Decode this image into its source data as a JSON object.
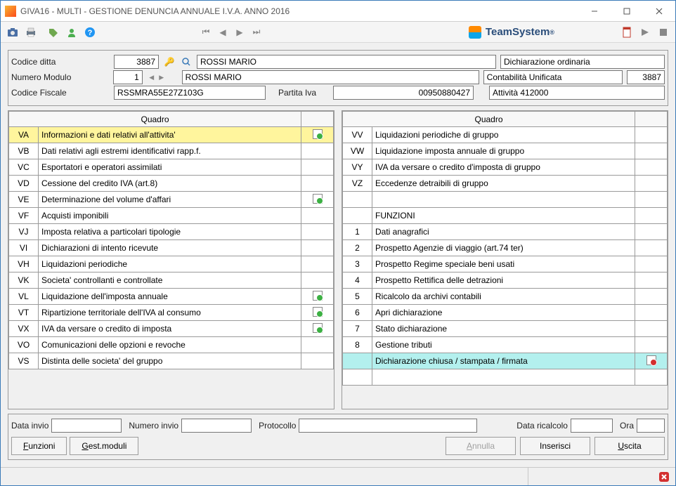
{
  "window": {
    "title": "GIVA16  - MULTI -  GESTIONE DENUNCIA ANNUALE I.V.A. ANNO 2016"
  },
  "brand": "TeamSystem",
  "header": {
    "codice_ditta_lbl": "Codice ditta",
    "codice_ditta": "3887",
    "nome1": "ROSSI MARIO",
    "dichiarazione": "Dichiarazione ordinaria",
    "numero_modulo_lbl": "Numero Modulo",
    "numero_modulo": "1",
    "nome2": "ROSSI MARIO",
    "contab_lbl": "Contabilità Unificata",
    "contab_val": "3887",
    "codice_fiscale_lbl": "Codice Fiscale",
    "codice_fiscale": "RSSMRA55E27Z103G",
    "partita_iva_lbl": "Partita Iva",
    "partita_iva": "00950880427",
    "attivita": "Attività 412000"
  },
  "table_header": "Quadro",
  "left_rows": [
    {
      "code": "VA",
      "desc": "Informazioni e dati relativi all'attivita'",
      "flag": true,
      "selected": true
    },
    {
      "code": "VB",
      "desc": "Dati relativi agli estremi identificativi rapp.f."
    },
    {
      "code": "VC",
      "desc": "Esportatori e operatori assimilati"
    },
    {
      "code": "VD",
      "desc": "Cessione del credito IVA (art.8)"
    },
    {
      "code": "VE",
      "desc": "Determinazione del volume d'affari",
      "flag": true
    },
    {
      "code": "VF",
      "desc": "Acquisti imponibili"
    },
    {
      "code": "VJ",
      "desc": "Imposta relativa a particolari tipologie"
    },
    {
      "code": "VI",
      "desc": "Dichiarazioni di intento ricevute"
    },
    {
      "code": "VH",
      "desc": "Liquidazioni periodiche"
    },
    {
      "code": "VK",
      "desc": "Societa' controllanti e controllate"
    },
    {
      "code": "VL",
      "desc": "Liquidazione dell'imposta annuale",
      "flag": true
    },
    {
      "code": "VT",
      "desc": "Ripartizione territoriale dell'IVA al consumo",
      "flag": true
    },
    {
      "code": "VX",
      "desc": "IVA da versare o credito di imposta",
      "flag": true
    },
    {
      "code": "VO",
      "desc": "Comunicazioni delle opzioni e revoche"
    },
    {
      "code": "VS",
      "desc": "Distinta delle societa' del gruppo"
    }
  ],
  "right_rows": [
    {
      "code": "VV",
      "desc": "Liquidazioni periodiche di gruppo"
    },
    {
      "code": "VW",
      "desc": "Liquidazione imposta annuale di gruppo"
    },
    {
      "code": "VY",
      "desc": "IVA da versare o credito d'imposta di gruppo"
    },
    {
      "code": "VZ",
      "desc": "Eccedenze detraibili di gruppo"
    },
    {
      "code": "",
      "desc": ""
    },
    {
      "code": "",
      "desc": "FUNZIONI"
    },
    {
      "code": "1",
      "desc": "Dati anagrafici"
    },
    {
      "code": "2",
      "desc": "Prospetto Agenzie di viaggio (art.74 ter)"
    },
    {
      "code": "3",
      "desc": "Prospetto Regime speciale beni usati"
    },
    {
      "code": "4",
      "desc": "Prospetto Rettifica delle detrazioni"
    },
    {
      "code": "5",
      "desc": "Ricalcolo da archivi contabili"
    },
    {
      "code": "6",
      "desc": "Apri dichiarazione"
    },
    {
      "code": "7",
      "desc": "Stato dichiarazione"
    },
    {
      "code": "8",
      "desc": "Gestione tributi"
    },
    {
      "code": "",
      "desc": "Dichiarazione chiusa / stampata / firmata",
      "cyan": true,
      "flagred": true
    },
    {
      "code": "",
      "desc": ""
    }
  ],
  "footer": {
    "data_invio_lbl": "Data invio",
    "numero_invio_lbl": "Numero invio",
    "protocollo_lbl": "Protocollo",
    "data_ricalcolo_lbl": "Data ricalcolo",
    "ora_lbl": "Ora"
  },
  "buttons": {
    "funzioni": "Funzioni",
    "gest_moduli": "Gest.moduli",
    "annulla": "Annulla",
    "inserisci": "Inserisci",
    "uscita": "Uscita"
  }
}
